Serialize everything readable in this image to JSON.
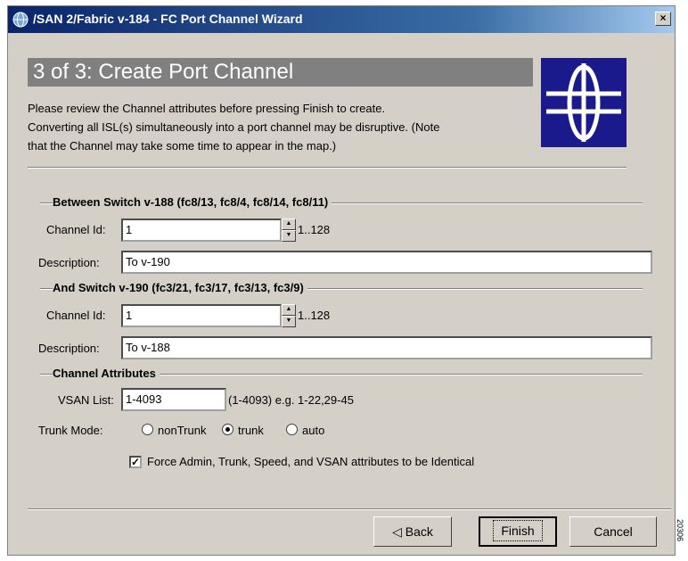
{
  "window": {
    "title": "/SAN 2/Fabric v-184 - FC Port Channel Wizard",
    "close_label": "×"
  },
  "header": {
    "step_title": "3 of 3: Create Port Channel",
    "intro_line1": "Please review the Channel attributes before pressing Finish to create.",
    "intro_line2": "Converting all ISL(s) simultaneously into a port channel may be disruptive. (Note",
    "intro_line3": "that the Channel may take some time to appear in the map.)"
  },
  "switch_a": {
    "legend": "Between Switch v-188 (fc8/13, fc8/4, fc8/14, fc8/11)",
    "channel_id_label": "Channel Id:",
    "channel_id_value": "1",
    "range": "1..128",
    "description_label": "Description:",
    "description_value": "To v-190"
  },
  "switch_b": {
    "legend": "And Switch v-190 (fc3/21, fc3/17, fc3/13, fc3/9)",
    "channel_id_label": "Channel Id:",
    "channel_id_value": "1",
    "range": "1..128",
    "description_label": "Description:",
    "description_value": "To v-188"
  },
  "attributes": {
    "legend": "Channel Attributes",
    "vsan_label": "VSAN List:",
    "vsan_value": "1-4093",
    "vsan_hint": "(1-4093) e.g. 1-22,29-45",
    "trunk_label": "Trunk Mode:",
    "trunk_options": [
      "nonTrunk",
      "trunk",
      "auto"
    ],
    "trunk_selected": "trunk",
    "force_label": "Force Admin, Trunk, Speed, and VSAN attributes to be Identical",
    "force_checked": true
  },
  "buttons": {
    "back": "Back",
    "finish": "Finish",
    "cancel": "Cancel"
  },
  "side_code": "20306",
  "colors": {
    "titlebar": "#0a246a",
    "dialog_bg": "#d4d0c8",
    "banner": "#808080",
    "logo_bg": "#1a1a8c"
  }
}
